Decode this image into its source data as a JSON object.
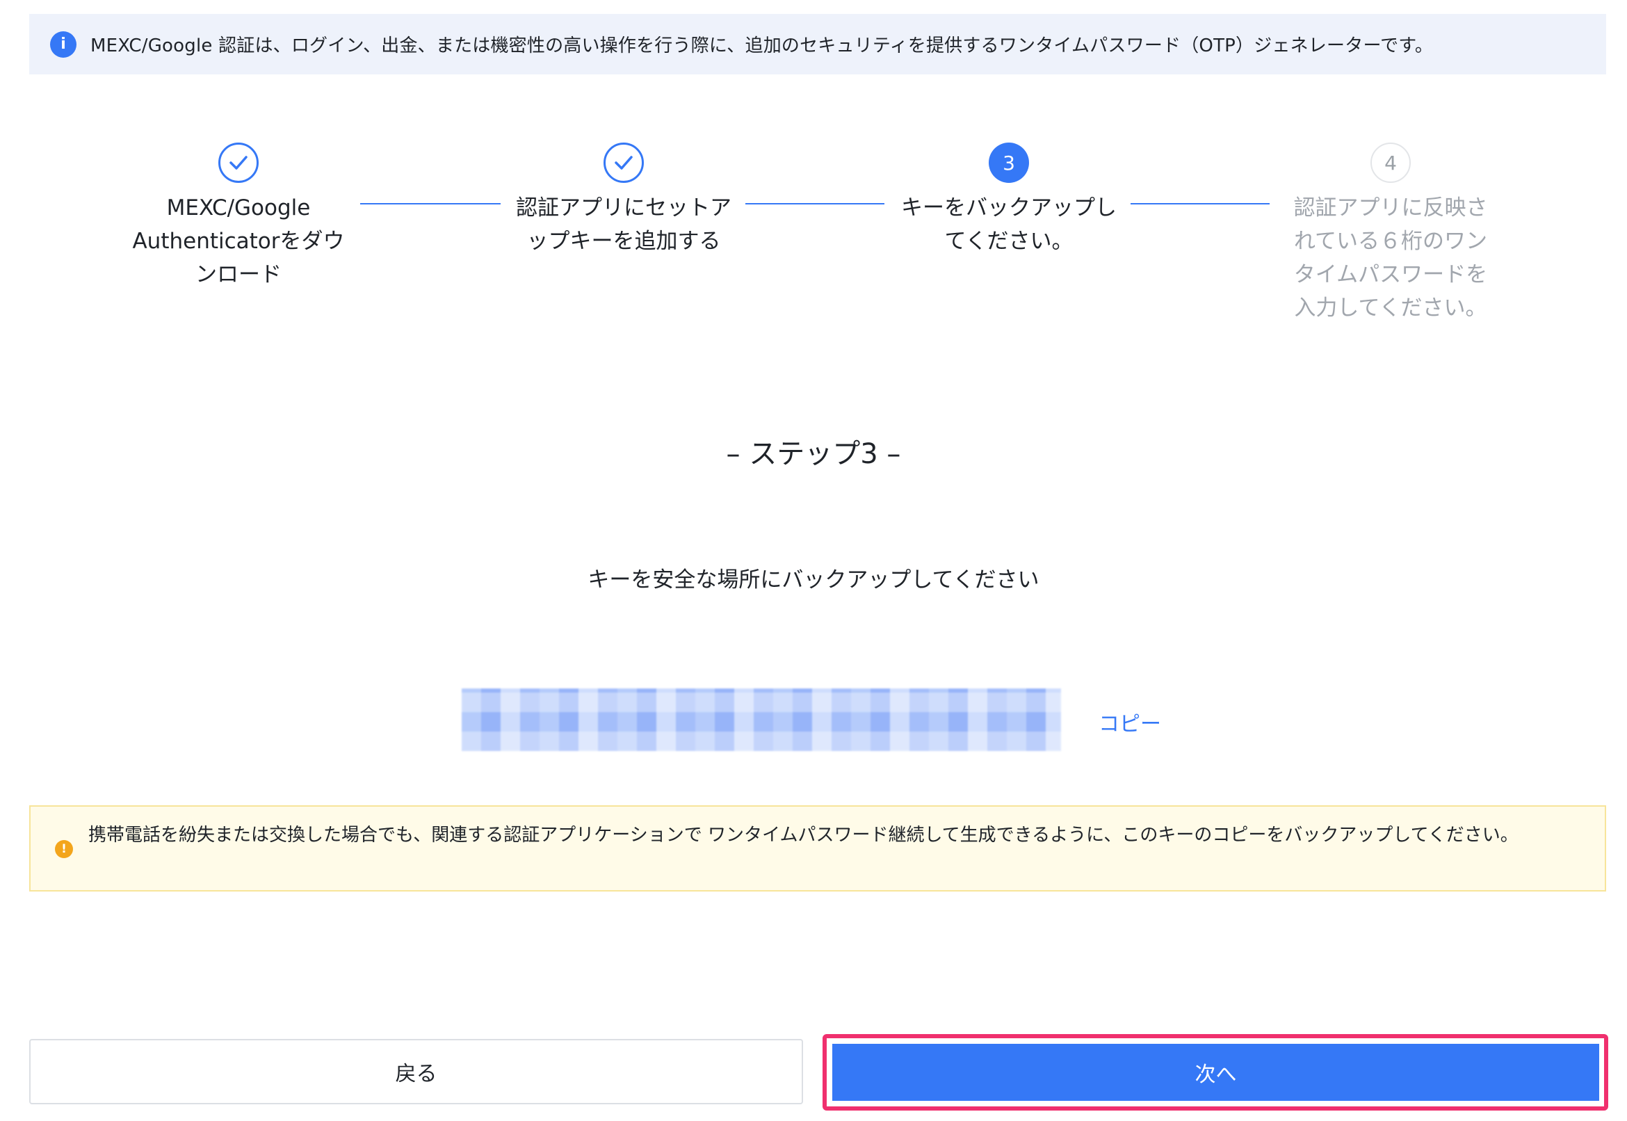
{
  "info_bar": {
    "icon": "info-icon",
    "text": "MEXC/Google 認証は、ログイン、出金、または機密性の高い操作を行う際に、追加のセキュリティを提供するワンタイムパスワード（OTP）ジェネレーターです。"
  },
  "steps": [
    {
      "number": "1",
      "status": "done",
      "label": "MEXC/Google Authenticatorをダウンロード"
    },
    {
      "number": "2",
      "status": "done",
      "label": "認証アプリにセットアップキーを追加する"
    },
    {
      "number": "3",
      "status": "active",
      "label": "キーをバックアップしてください。"
    },
    {
      "number": "4",
      "status": "pending",
      "label": "認証アプリに反映されている６桁のワンタイムパスワードを入力してください。"
    }
  ],
  "step_title": "– ステップ3 –",
  "subtitle": "キーを安全な場所にバックアップしてください",
  "copy_label": "コピー",
  "warning": {
    "icon": "warning-icon",
    "text": "携帯電話を紛失または交換した場合でも、関連する認証アプリケーションで ワンタイムパスワード継続して生成できるように、このキーのコピーをバックアップしてください。"
  },
  "buttons": {
    "back": "戻る",
    "next": "次へ"
  },
  "colors": {
    "accent": "#3578f6",
    "highlight": "#f0306e",
    "warning_bg": "#fffbe8",
    "info_bg": "#eef2fb"
  }
}
